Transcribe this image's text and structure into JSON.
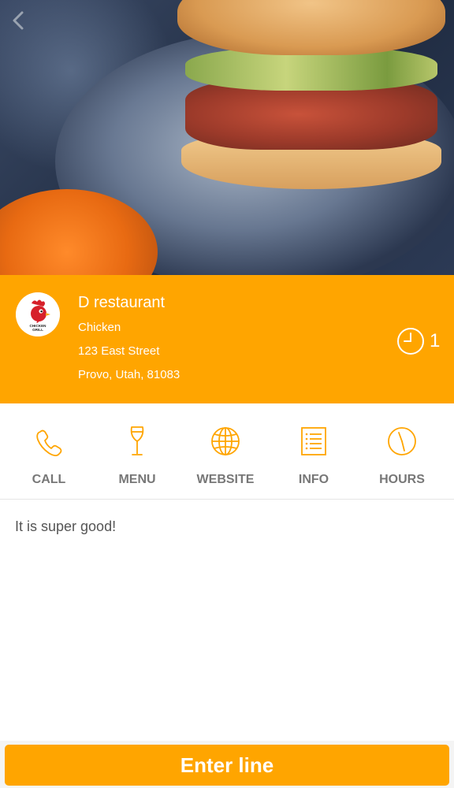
{
  "header": {
    "back_icon": "chevron-left-icon"
  },
  "restaurant": {
    "name": "D restaurant",
    "category": "Chicken",
    "street": "123 East Street",
    "city_line": "Provo, Utah, 81083",
    "logo_text_line1": "CHICKEN",
    "logo_text_line2": "GRILL",
    "wait_icon": "clock-icon",
    "wait_count": "1"
  },
  "actions": [
    {
      "label": "CALL",
      "icon": "phone-icon"
    },
    {
      "label": "MENU",
      "icon": "wine-glass-icon"
    },
    {
      "label": "WEBSITE",
      "icon": "globe-icon"
    },
    {
      "label": "INFO",
      "icon": "list-icon"
    },
    {
      "label": "HOURS",
      "icon": "clock-icon"
    }
  ],
  "description": "It is super good!",
  "footer": {
    "button_label": "Enter line"
  },
  "colors": {
    "accent": "#ffa500",
    "label_gray": "#777777"
  }
}
